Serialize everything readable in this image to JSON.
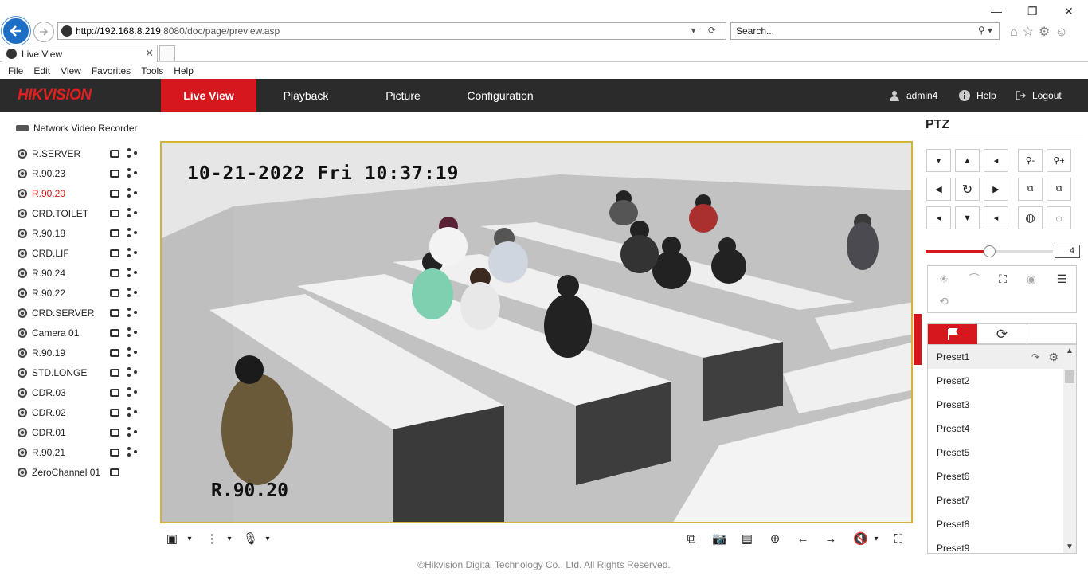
{
  "browser": {
    "url_host": "http://192.168.8.219",
    "url_rest": ":8080/doc/page/preview.asp",
    "search_placeholder": "Search...",
    "tab_title": "Live View",
    "menu": [
      "File",
      "Edit",
      "View",
      "Favorites",
      "Tools",
      "Help"
    ]
  },
  "nav": {
    "logo": "HIKVISION",
    "items": [
      "Live View",
      "Playback",
      "Picture",
      "Configuration"
    ],
    "active": "Live View",
    "user": "admin4",
    "help": "Help",
    "logout": "Logout",
    "accent": "#d6171d"
  },
  "device_tree": {
    "root": "Network Video Recorder",
    "cameras": [
      {
        "name": "R.SERVER"
      },
      {
        "name": "R.90.23"
      },
      {
        "name": "R.90.20",
        "active": true
      },
      {
        "name": "CRD.TOILET"
      },
      {
        "name": "R.90.18"
      },
      {
        "name": "CRD.LIF"
      },
      {
        "name": "R.90.24"
      },
      {
        "name": "R.90.22"
      },
      {
        "name": "CRD.SERVER"
      },
      {
        "name": "Camera 01"
      },
      {
        "name": "R.90.19"
      },
      {
        "name": "STD.LONGE"
      },
      {
        "name": "CDR.03"
      },
      {
        "name": "CDR.02"
      },
      {
        "name": "CDR.01"
      },
      {
        "name": "R.90.21"
      },
      {
        "name": "ZeroChannel 01"
      }
    ]
  },
  "video": {
    "osd_datetime": "10-21-2022 Fri 10:37:19",
    "osd_channel": "R.90.20"
  },
  "ptz": {
    "title": "PTZ",
    "speed": "4",
    "speed_fraction": 0.5,
    "presets": [
      "Preset1",
      "Preset2",
      "Preset3",
      "Preset4",
      "Preset5",
      "Preset6",
      "Preset7",
      "Preset8",
      "Preset9"
    ]
  },
  "footer": "©Hikvision Digital Technology Co., Ltd. All Rights Reserved."
}
